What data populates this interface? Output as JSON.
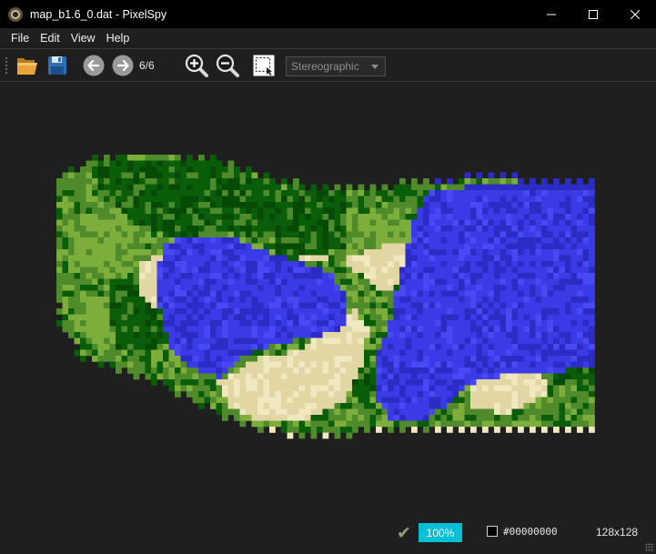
{
  "window": {
    "title": "map_b1.6_0.dat - PixelSpy",
    "app_icon": "app-eye-icon",
    "controls": [
      "minimize-icon",
      "maximize-icon",
      "close-icon"
    ]
  },
  "menu": {
    "items": [
      {
        "label": "File"
      },
      {
        "label": "Edit"
      },
      {
        "label": "View"
      },
      {
        "label": "Help"
      }
    ]
  },
  "toolbar": {
    "icons": [
      "open-folder-icon",
      "save-icon",
      "previous-icon",
      "next-icon",
      "zoom-in-icon",
      "zoom-out-icon",
      "selection-icon"
    ],
    "page_counter": "6/6",
    "projection": "Stereographic"
  },
  "status": {
    "zoom": "100%",
    "color_value": "#00000000",
    "dimensions": "128x128"
  },
  "colors": {
    "accent": "#00c0d6",
    "background": "#1f1f1f",
    "titlebar": "#000000"
  },
  "map": {
    "palette": {
      "forest": "#0a5e0a",
      "forest_dark": "#064a06",
      "grass": "#4f8b2a",
      "grass_light": "#7dad3b",
      "sand": "#e2d7a4",
      "sand_light": "#f0e8c0",
      "water": "#3a3ae6",
      "water_dark": "#2c2cc4",
      "water_light": "#4848f5"
    }
  }
}
